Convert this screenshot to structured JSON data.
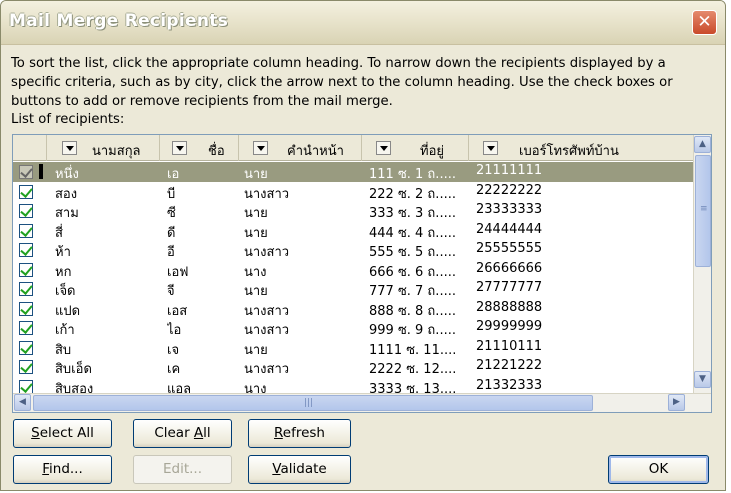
{
  "window": {
    "title": "Mail Merge Recipients",
    "close_glyph": "✕"
  },
  "instructions": "To sort the list, click the appropriate column heading.  To narrow down the recipients displayed by a specific criteria, such as by city, click the arrow next to the column heading.  Use the check boxes or buttons to add or remove recipients from the mail merge.",
  "list_label": "List of recipients:",
  "columns": [
    "นามสกุล",
    "ชื่อ",
    "คำนำหน้า",
    "ที่อยู่",
    "เบอร์โทรศัพท์บ้าน"
  ],
  "rows": [
    {
      "c": [
        "หนึ่ง",
        "เอ",
        "นาย",
        "111 ซ. 1 ถ.....",
        "21111111"
      ],
      "checked": true,
      "selected": true
    },
    {
      "c": [
        "สอง",
        "บี",
        "นางสาว",
        "222 ซ. 2 ถ.....",
        "22222222"
      ],
      "checked": true
    },
    {
      "c": [
        "สาม",
        "ซี",
        "นาย",
        "333 ซ. 3 ถ.....",
        "23333333"
      ],
      "checked": true
    },
    {
      "c": [
        "สี่",
        "ดี",
        "นาย",
        "444 ซ. 4 ถ.....",
        "24444444"
      ],
      "checked": true
    },
    {
      "c": [
        "ห้า",
        "อี",
        "นางสาว",
        "555 ซ. 5 ถ.....",
        "25555555"
      ],
      "checked": true
    },
    {
      "c": [
        "หก",
        "เอฟ",
        "นาง",
        "666 ซ. 6 ถ.....",
        "26666666"
      ],
      "checked": true
    },
    {
      "c": [
        "เจ็ด",
        "จี",
        "นาย",
        "777 ซ. 7 ถ.....",
        "27777777"
      ],
      "checked": true
    },
    {
      "c": [
        "แปด",
        "เอส",
        "นางสาว",
        "888 ซ. 8 ถ.....",
        "28888888"
      ],
      "checked": true
    },
    {
      "c": [
        "เก้า",
        "ไอ",
        "นางสาว",
        "999 ซ. 9 ถ.....",
        "29999999"
      ],
      "checked": true
    },
    {
      "c": [
        "สิบ",
        "เจ",
        "นาย",
        "1111 ซ. 11....",
        "21110111"
      ],
      "checked": true
    },
    {
      "c": [
        "สิบเอ็ด",
        "เค",
        "นางสาว",
        "2222 ซ. 12....",
        "21221222"
      ],
      "checked": true
    },
    {
      "c": [
        "สิบสอง",
        "แอล",
        "นาง",
        "3333 ซ. 13....",
        "21332333"
      ],
      "checked": true
    }
  ],
  "buttons": {
    "select_all": {
      "u": "S",
      "rest": "elect All"
    },
    "clear_all": {
      "pre": "Clear ",
      "u": "A",
      "rest": "ll"
    },
    "refresh": {
      "u": "R",
      "rest": "efresh"
    },
    "find": {
      "u": "F",
      "rest": "ind..."
    },
    "edit": "Edit...",
    "validate": {
      "u": "V",
      "rest": "alidate"
    },
    "ok": "OK"
  },
  "scroll": {
    "up": "▲",
    "down": "▼",
    "left": "◀",
    "right": "▶",
    "grip_v": "≡",
    "grip_h": "|||"
  }
}
